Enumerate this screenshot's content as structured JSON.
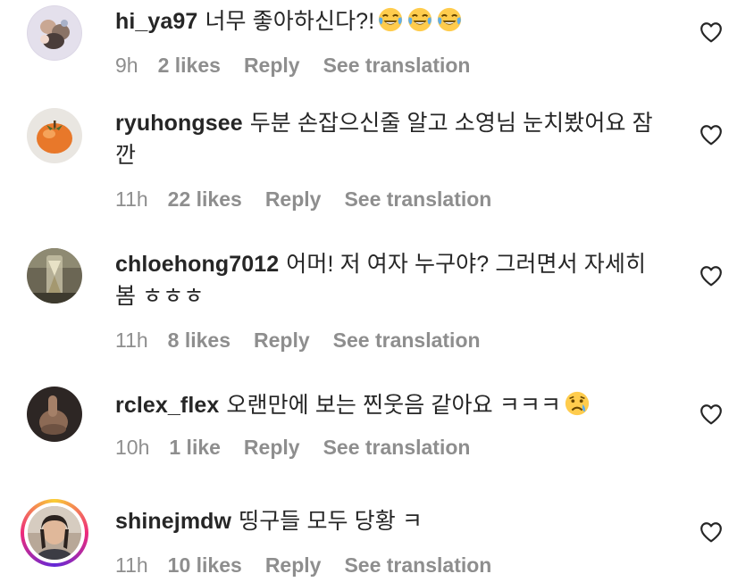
{
  "colors": {
    "text": "#262626",
    "muted": "#8e8e8e",
    "story_ring": "#ee2a7b"
  },
  "comments": [
    {
      "username": "hi_ya97",
      "text": "너무 좋아하신다?!",
      "emojis": [
        "face-with-tears-of-joy-icon",
        "face-with-tears-of-joy-icon",
        "face-with-tears-of-joy-icon"
      ],
      "time": "9h",
      "likes": "2 likes",
      "reply": "Reply",
      "translate": "See translation"
    },
    {
      "username": "ryuhongsee",
      "text": "두분 손잡으신줄 알고 소영님 눈치봤어요 잠깐",
      "time": "11h",
      "likes": "22 likes",
      "reply": "Reply",
      "translate": "See translation"
    },
    {
      "username": "chloehong7012",
      "text": "어머! 저 여자 누구야? 그러면서 자세히 봄 ㅎㅎㅎ",
      "time": "11h",
      "likes": "8 likes",
      "reply": "Reply",
      "translate": "See translation"
    },
    {
      "username": "rclex_flex",
      "text": "오랜만에 보는 찐웃음 같아요 ㅋㅋㅋ",
      "emojis": [
        "crying-face-icon"
      ],
      "time": "10h",
      "likes": "1 like",
      "reply": "Reply",
      "translate": "See translation"
    },
    {
      "username": "shinejmdw",
      "text": "띵구들 모두 당황 ㅋ",
      "time": "11h",
      "likes": "10 likes",
      "reply": "Reply",
      "translate": "See translation"
    }
  ]
}
